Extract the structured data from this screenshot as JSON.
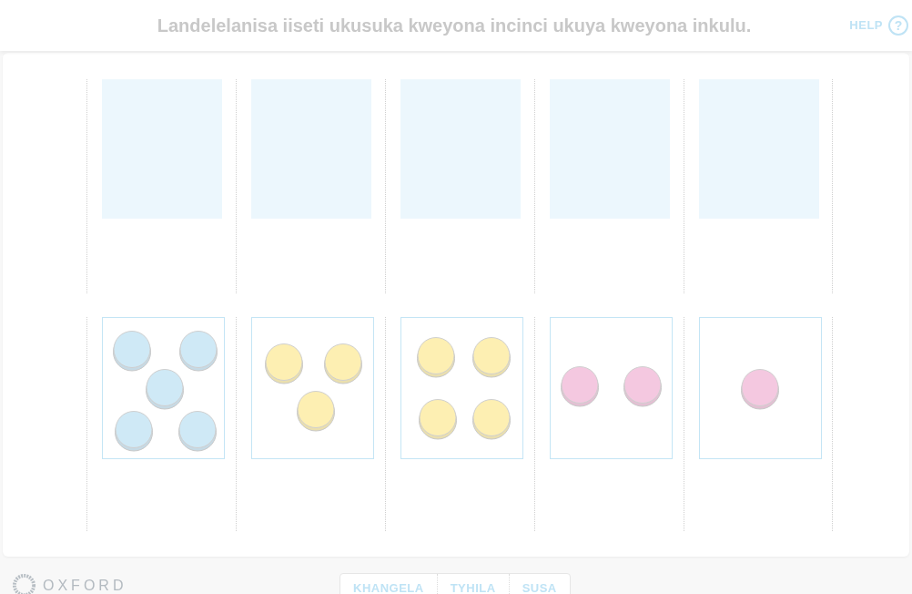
{
  "header": {
    "instruction": "Landelelanisa iiseti ukusuka kweyona incinci ukuya kweyona inkulu.",
    "help": {
      "label": "HELP",
      "icon": "?"
    }
  },
  "columns": [
    {
      "card": {
        "counters": [
          {
            "color": "#cfe9f6"
          },
          {
            "color": "#cfe9f6"
          },
          {
            "color": "#cfe9f6"
          },
          {
            "color": "#cfe9f6"
          },
          {
            "color": "#cfe9f6"
          }
        ]
      }
    },
    {
      "card": {
        "counters": [
          {
            "color": "#fdefb2"
          },
          {
            "color": "#fdefb2"
          },
          {
            "color": "#fdefb2"
          }
        ]
      }
    },
    {
      "card": {
        "counters": [
          {
            "color": "#fdefb2"
          },
          {
            "color": "#fdefb2"
          },
          {
            "color": "#fdefb2"
          },
          {
            "color": "#fdefb2"
          }
        ]
      }
    },
    {
      "card": {
        "counters": [
          {
            "color": "#f4c8e0"
          },
          {
            "color": "#f4c8e0"
          }
        ]
      }
    },
    {
      "card": {
        "counters": [
          {
            "color": "#f4c8e0"
          }
        ]
      }
    }
  ],
  "footer": {
    "logo": "OXFORD",
    "buttons": [
      "KHANGELA",
      "TYHILA",
      "SUSA"
    ]
  }
}
